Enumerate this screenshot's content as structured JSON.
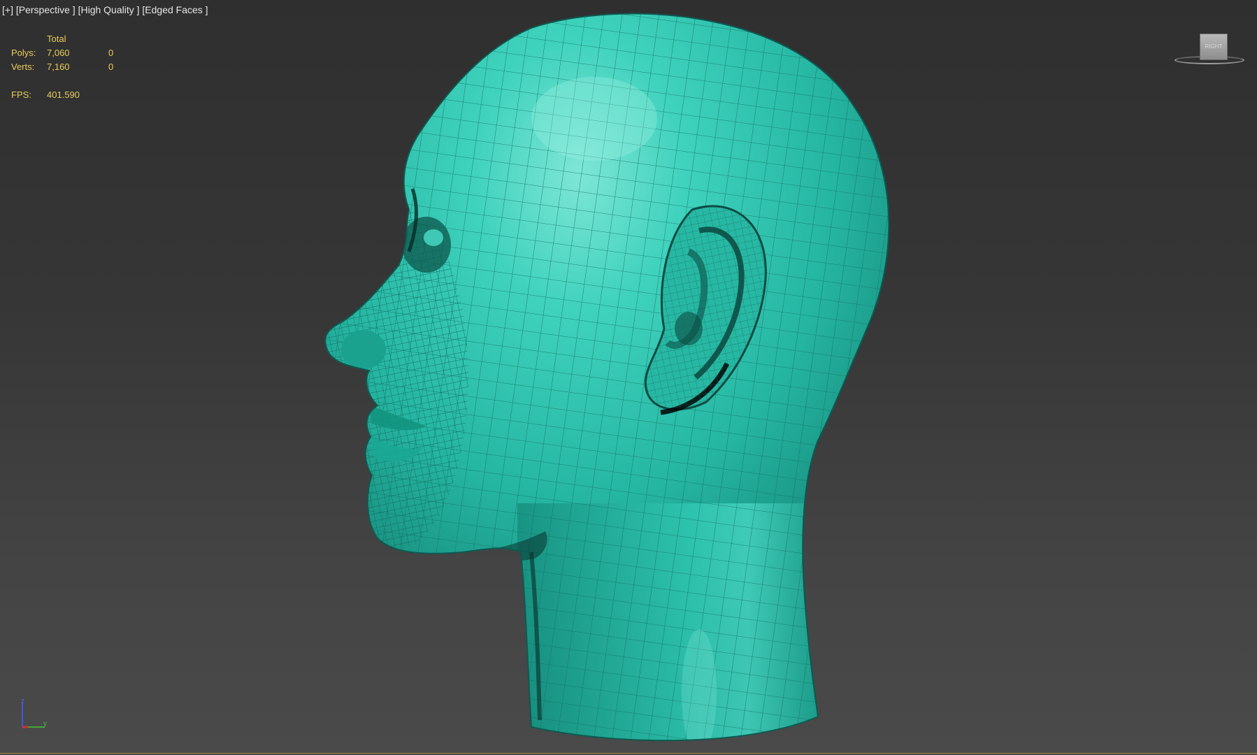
{
  "viewport": {
    "labels": {
      "menu": "[+]",
      "view": "[Perspective ]",
      "shading": "[High Quality ]",
      "mode": "[Edged Faces ]"
    }
  },
  "stats": {
    "header": "Total",
    "polys_label": "Polys:",
    "polys_total": "7,060",
    "polys_selected": "0",
    "verts_label": "Verts:",
    "verts_total": "7,160",
    "verts_selected": "0",
    "fps_label": "FPS:",
    "fps_value": "401.590",
    "color": "#e8cc5a"
  },
  "viewcube": {
    "face_label": "RIGHT"
  },
  "axis": {
    "z": "z",
    "y": "y"
  },
  "model": {
    "color": "#2bbfa8",
    "wire_color": "#16665a"
  }
}
